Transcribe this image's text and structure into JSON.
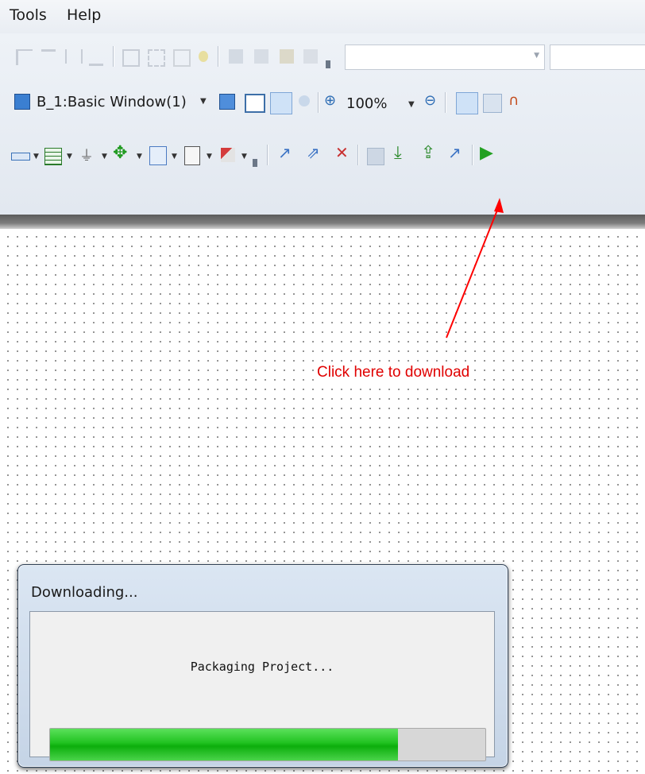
{
  "menu": {
    "tools": "Tools",
    "help": "Help"
  },
  "toolbar": {
    "window_select_label": "B_1:Basic Window(1)",
    "zoom_level": "100%",
    "icons_row1": [
      "align-left-icon",
      "align-top-icon",
      "align-center-icon",
      "align-bottom-icon",
      "group-icon",
      "ungroup-icon",
      "make-same-size-icon",
      "nudge-icon",
      "copy-icon",
      "paste-icon",
      "layer-up-icon",
      "layer-down-icon",
      "toolbar-overflow-icon"
    ],
    "icons_row3": [
      "ruler-icon",
      "table-icon",
      "valve-icon",
      "move-icon",
      "window-object-icon",
      "note-icon",
      "component-icon",
      "compile-icon",
      "compile-all-icon",
      "stop-compile-icon",
      "download-icon",
      "upload-icon",
      "export-icon",
      "simulate-icon",
      "run-icon"
    ]
  },
  "annotation": {
    "text": "Click here to download",
    "color": "#e00000"
  },
  "dialog": {
    "title": "Downloading...",
    "status": "Packaging Project...",
    "progress": 0.8
  },
  "colors": {
    "progress_green": "#20c220",
    "annotation_red": "#e00000"
  }
}
